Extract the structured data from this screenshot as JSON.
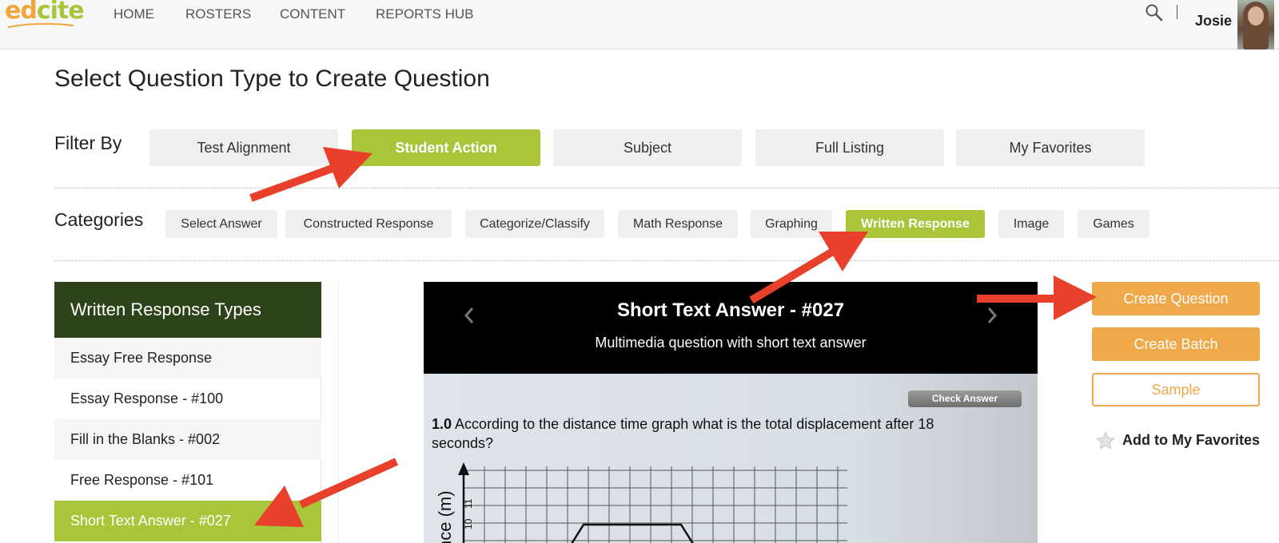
{
  "app": {
    "logo_part1": "ed",
    "logo_part2": "cite"
  },
  "nav": {
    "items": [
      "HOME",
      "ROSTERS",
      "CONTENT",
      "REPORTS HUB"
    ],
    "username": "Josie"
  },
  "page": {
    "title": "Select Question Type to Create Question"
  },
  "filter": {
    "label": "Filter By",
    "options": [
      "Test Alignment",
      "Student Action",
      "Subject",
      "Full Listing",
      "My Favorites"
    ],
    "active": "Student Action"
  },
  "categories": {
    "label": "Categories",
    "options": [
      "Select Answer",
      "Constructed Response",
      "Categorize/Classify",
      "Math Response",
      "Graphing",
      "Written Response",
      "Image",
      "Games"
    ],
    "active": "Written Response"
  },
  "sidebar": {
    "header": "Written Response Types",
    "items": [
      "Essay Free Response",
      "Essay Response - #100",
      "Fill in the Blanks - #002",
      "Free Response - #101",
      "Short Text Answer - #027"
    ],
    "active": "Short Text Answer - #027"
  },
  "preview": {
    "title": "Short Text Answer - #027",
    "subtitle": "Multimedia question with short text answer",
    "check_answer_label": "Check Answer",
    "question_number": "1.0",
    "question_text": "According to the distance time graph what is the total displacement after 18 seconds?",
    "axis_label": "nce (m)",
    "tick_labels": [
      "11",
      "10"
    ]
  },
  "actions": {
    "create_question": "Create Question",
    "create_batch": "Create Batch",
    "sample": "Sample",
    "add_favorites": "Add to My Favorites"
  },
  "colors": {
    "accent_green": "#a9c63b",
    "dark_green": "#2d4319",
    "orange": "#f0a94a",
    "annotation_red": "#e8402a"
  }
}
